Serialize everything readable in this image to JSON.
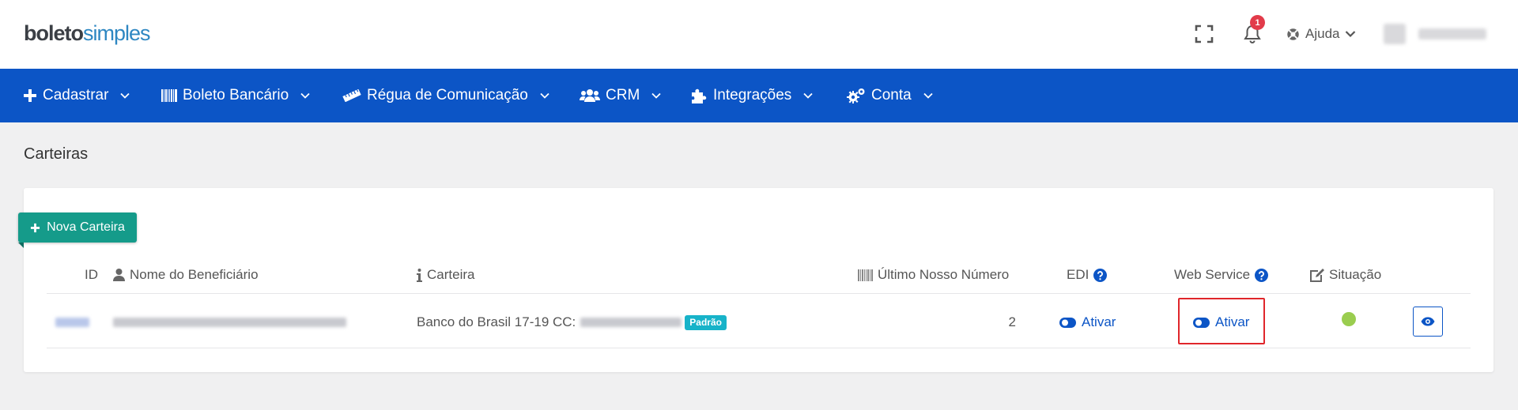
{
  "header": {
    "logo_bold": "boleto",
    "logo_light": "simples",
    "notifications_count": "1",
    "help_label": "Ajuda"
  },
  "nav": {
    "items": [
      {
        "label": "Cadastrar",
        "icon": "plus-icon"
      },
      {
        "label": "Boleto Bancário",
        "icon": "barcode-icon"
      },
      {
        "label": "Régua de Comunicação",
        "icon": "ruler-icon"
      },
      {
        "label": "CRM",
        "icon": "users-icon"
      },
      {
        "label": "Integrações",
        "icon": "puzzle-icon"
      },
      {
        "label": "Conta",
        "icon": "cogs-icon"
      }
    ]
  },
  "page": {
    "title": "Carteiras",
    "new_button_label": "Nova Carteira"
  },
  "table": {
    "columns": {
      "id": "ID",
      "beneficiary": "Nome do Beneficiário",
      "wallet": "Carteira",
      "last_number": "Último Nosso Número",
      "edi": "EDI",
      "web_service": "Web Service",
      "status": "Situação"
    },
    "rows": [
      {
        "wallet": "Banco do Brasil 17-19 CC:",
        "default_badge": "Padrão",
        "last_number": "2",
        "edi_action": "Ativar",
        "web_service_action": "Ativar",
        "status_color": "#9acd4f"
      }
    ]
  },
  "colors": {
    "brand_blue": "#0c55c6",
    "teal_button": "#159b8a",
    "badge_cyan": "#17b3c9",
    "notification_red": "#e23b4a",
    "highlight_red": "#e0262b"
  }
}
